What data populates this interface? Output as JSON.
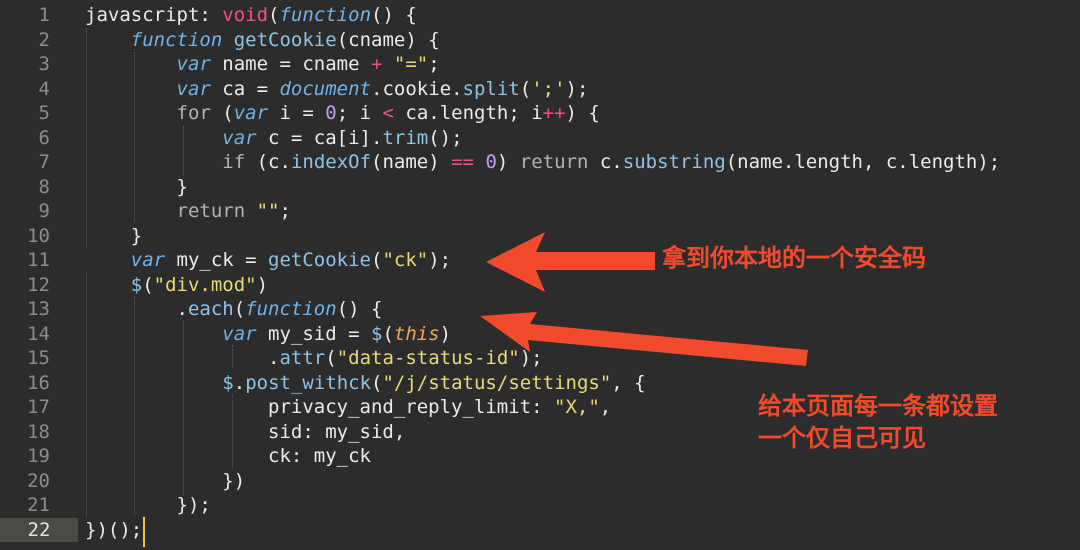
{
  "editor": {
    "lines": [
      {
        "n": "1",
        "segs": [
          [
            "pu",
            "javascript: "
          ],
          [
            "op",
            "void"
          ],
          [
            "pu",
            "("
          ],
          [
            "kw",
            "function"
          ],
          [
            "pu",
            "() {"
          ]
        ]
      },
      {
        "n": "2",
        "segs": [
          [
            "pu",
            "    "
          ],
          [
            "kw",
            "function"
          ],
          [
            "pu",
            " "
          ],
          [
            "fn",
            "getCookie"
          ],
          [
            "pu",
            "(cname) {"
          ]
        ]
      },
      {
        "n": "3",
        "segs": [
          [
            "pu",
            "        "
          ],
          [
            "kw",
            "var"
          ],
          [
            "pu",
            " name = cname "
          ],
          [
            "op",
            "+"
          ],
          [
            "pu",
            " "
          ],
          [
            "st",
            "\"=\""
          ],
          [
            "pu",
            ";"
          ]
        ]
      },
      {
        "n": "4",
        "segs": [
          [
            "pu",
            "        "
          ],
          [
            "kw",
            "var"
          ],
          [
            "pu",
            " ca = "
          ],
          [
            "kw",
            "document"
          ],
          [
            "pu",
            "."
          ],
          [
            "pu",
            "cookie."
          ],
          [
            "fn",
            "split"
          ],
          [
            "pu",
            "("
          ],
          [
            "st",
            "';'"
          ],
          [
            "pu",
            ");"
          ]
        ]
      },
      {
        "n": "5",
        "segs": [
          [
            "pu",
            "        "
          ],
          [
            "ctl",
            "for"
          ],
          [
            "pu",
            " ("
          ],
          [
            "kw",
            "var"
          ],
          [
            "pu",
            " i = "
          ],
          [
            "nm",
            "0"
          ],
          [
            "pu",
            "; i "
          ],
          [
            "op",
            "<"
          ],
          [
            "pu",
            " ca.length; i"
          ],
          [
            "op",
            "++"
          ],
          [
            "pu",
            ") {"
          ]
        ]
      },
      {
        "n": "6",
        "segs": [
          [
            "pu",
            "            "
          ],
          [
            "kw",
            "var"
          ],
          [
            "pu",
            " c = ca[i]."
          ],
          [
            "fn",
            "trim"
          ],
          [
            "pu",
            "();"
          ]
        ]
      },
      {
        "n": "7",
        "segs": [
          [
            "pu",
            "            "
          ],
          [
            "ctl",
            "if"
          ],
          [
            "pu",
            " (c."
          ],
          [
            "fn",
            "indexOf"
          ],
          [
            "pu",
            "(name) "
          ],
          [
            "op",
            "=="
          ],
          [
            "pu",
            " "
          ],
          [
            "nm",
            "0"
          ],
          [
            "pu",
            ") "
          ],
          [
            "ctl",
            "return"
          ],
          [
            "pu",
            " c."
          ],
          [
            "fn",
            "substring"
          ],
          [
            "pu",
            "(name.length, c.length);"
          ]
        ]
      },
      {
        "n": "8",
        "segs": [
          [
            "pu",
            "        }"
          ]
        ]
      },
      {
        "n": "9",
        "segs": [
          [
            "pu",
            "        "
          ],
          [
            "ctl",
            "return"
          ],
          [
            "pu",
            " "
          ],
          [
            "st",
            "\"\""
          ],
          [
            "pu",
            ";"
          ]
        ]
      },
      {
        "n": "10",
        "segs": [
          [
            "pu",
            "    }"
          ]
        ]
      },
      {
        "n": "11",
        "segs": [
          [
            "pu",
            "    "
          ],
          [
            "kw",
            "var"
          ],
          [
            "pu",
            " my_ck = "
          ],
          [
            "fn",
            "getCookie"
          ],
          [
            "pu",
            "("
          ],
          [
            "st",
            "\"ck\""
          ],
          [
            "pu",
            ");"
          ]
        ]
      },
      {
        "n": "12",
        "segs": [
          [
            "pu",
            "    "
          ],
          [
            "fn",
            "$"
          ],
          [
            "pu",
            "("
          ],
          [
            "st",
            "\"div.mod\""
          ],
          [
            "pu",
            ")"
          ]
        ]
      },
      {
        "n": "13",
        "segs": [
          [
            "pu",
            "        ."
          ],
          [
            "fn",
            "each"
          ],
          [
            "pu",
            "("
          ],
          [
            "kw",
            "function"
          ],
          [
            "pu",
            "() {"
          ]
        ]
      },
      {
        "n": "14",
        "segs": [
          [
            "pu",
            "            "
          ],
          [
            "kw",
            "var"
          ],
          [
            "pu",
            " my_sid = "
          ],
          [
            "fn",
            "$"
          ],
          [
            "pu",
            "("
          ],
          [
            "th",
            "this"
          ],
          [
            "pu",
            ")"
          ]
        ]
      },
      {
        "n": "15",
        "segs": [
          [
            "pu",
            "                ."
          ],
          [
            "fn",
            "attr"
          ],
          [
            "pu",
            "("
          ],
          [
            "st",
            "\"data-status-id\""
          ],
          [
            "pu",
            ");"
          ]
        ]
      },
      {
        "n": "16",
        "segs": [
          [
            "pu",
            "            "
          ],
          [
            "fn",
            "$"
          ],
          [
            "pu",
            "."
          ],
          [
            "fn",
            "post_withck"
          ],
          [
            "pu",
            "("
          ],
          [
            "st",
            "\"/j/status/settings\""
          ],
          [
            "pu",
            ", {"
          ]
        ]
      },
      {
        "n": "17",
        "segs": [
          [
            "pu",
            "                privacy_and_reply_limit: "
          ],
          [
            "st",
            "\"X,\""
          ],
          [
            "pu",
            ","
          ]
        ]
      },
      {
        "n": "18",
        "segs": [
          [
            "pu",
            "                sid: my_sid,"
          ]
        ]
      },
      {
        "n": "19",
        "segs": [
          [
            "pu",
            "                ck: my_ck"
          ]
        ]
      },
      {
        "n": "20",
        "segs": [
          [
            "pu",
            "            })"
          ]
        ]
      },
      {
        "n": "21",
        "segs": [
          [
            "pu",
            "        });"
          ]
        ]
      },
      {
        "n": "22",
        "segs": [
          [
            "pu",
            "})();"
          ]
        ]
      }
    ],
    "current_line": "22"
  },
  "annotations": {
    "first": "拿到你本地的一个安全码",
    "second_line1": "给本页面每一条都设置",
    "second_line2": "一个仅自己可见"
  },
  "colors": {
    "background": "#2c2c2c",
    "annotation": "#f24a2c",
    "cursor": "#f0c24b"
  }
}
